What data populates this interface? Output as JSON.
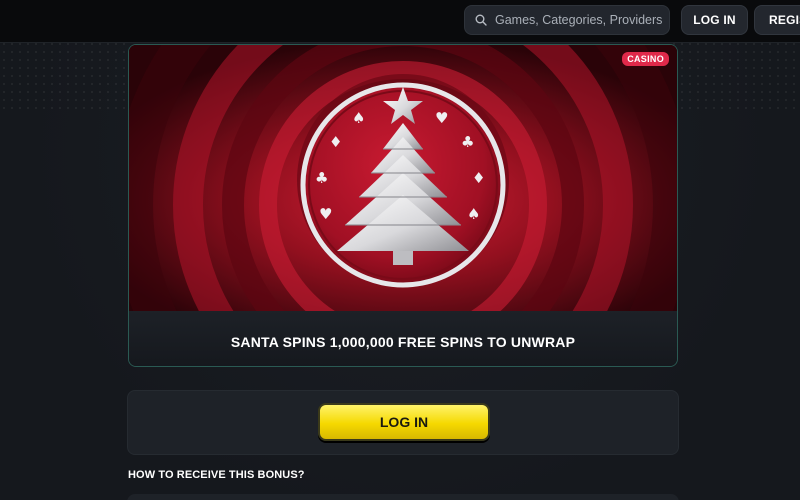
{
  "header": {
    "search": {
      "placeholder": "Games, Categories, Providers",
      "icon": "search-icon"
    },
    "login_label": "LOG IN",
    "register_label": "REGIS"
  },
  "promo": {
    "badge": "CASINO",
    "title": "SANTA SPINS 1,000,000 FREE SPINS TO UNWRAP"
  },
  "actions": {
    "login_label": "LOG IN"
  },
  "section": {
    "how_to_title": "HOW TO RECEIVE THIS BONUS?"
  },
  "colors": {
    "background": "#15181d",
    "header": "#090a0c",
    "accent_yellow": "#f5d900",
    "banner_red": "#c0182e",
    "badge": "#e0294a",
    "card_border": "#2a5a53"
  }
}
